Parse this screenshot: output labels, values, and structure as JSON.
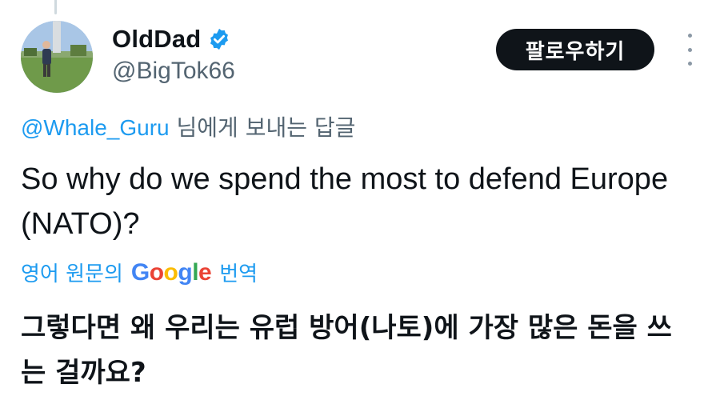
{
  "user": {
    "display_name": "OldDad",
    "handle": "@BigTok66",
    "verified": true
  },
  "actions": {
    "follow_label": "팔로우하기",
    "more_icon": "more-vertical-icon"
  },
  "reply": {
    "mention": "@Whale_Guru",
    "suffix": " 님에게 보내는 답글"
  },
  "tweet": {
    "text": "So why do we spend the most to defend Europe (NATO)?"
  },
  "translation": {
    "prefix": "영어 원문의",
    "brand_letters": [
      "G",
      "o",
      "o",
      "g",
      "l",
      "e"
    ],
    "suffix": "번역",
    "text": "그렇다면 왜 우리는 유럽 방어(나토)에 가장 많은 돈을 쓰는 걸까요?"
  },
  "colors": {
    "accent": "#1d9bf0",
    "text": "#0f1419",
    "muted": "#536471",
    "button_bg": "#0f1419"
  }
}
